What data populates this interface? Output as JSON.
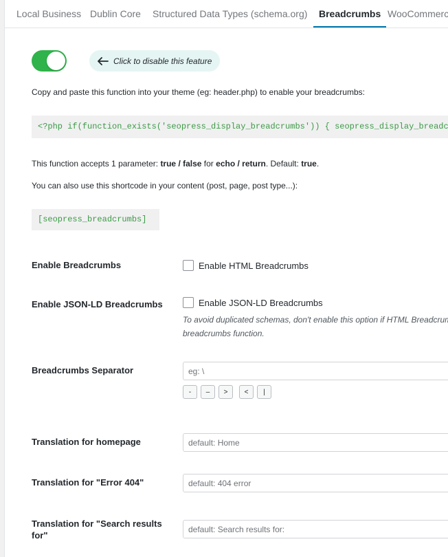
{
  "tabs": [
    {
      "label": "Local Business"
    },
    {
      "label": "Dublin Core"
    },
    {
      "label": "Structured Data Types (schema.org)"
    },
    {
      "label": "Breadcrumbs"
    },
    {
      "label": "WooCommerce"
    }
  ],
  "feature": {
    "toggle_on": true,
    "disable_label": "Click to disable this feature"
  },
  "intro": "Copy and paste this function into your theme (eg: header.php) to enable your breadcrumbs:",
  "code_function": "<?php if(function_exists('seopress_display_breadcrumbs')) { seopress_display_breadcrumbs(); } ?>",
  "param_note": {
    "a": "This function accepts 1 parameter: ",
    "b": "true / false",
    "c": " for ",
    "d": "echo / return",
    "e": ". Default: ",
    "f": "true",
    "g": "."
  },
  "shortcode_note": "You can also use this shortcode in your content (post, page, post type...):",
  "code_shortcode": "[seopress_breadcrumbs]",
  "fields": {
    "enable": {
      "label": "Enable Breadcrumbs",
      "checkbox": "Enable HTML Breadcrumbs",
      "checked": false
    },
    "jsonld": {
      "label": "Enable JSON-LD Breadcrumbs",
      "checkbox": "Enable JSON-LD Breadcrumbs",
      "checked": false,
      "desc1": "To avoid duplicated schemas, don't enable this option if HTML Breadcrumbs",
      "desc2": "breadcrumbs function."
    },
    "separator": {
      "label": "Breadcrumbs Separator",
      "placeholder": "eg: \\",
      "buttons": [
        "-",
        "–",
        ">",
        "<",
        "|"
      ]
    },
    "homepage": {
      "label": "Translation for homepage",
      "placeholder": "default: Home"
    },
    "error404": {
      "label": "Translation for \"Error 404\"",
      "placeholder": "default: 404 error"
    },
    "search": {
      "label1": "Translation for \"Search results",
      "label2": "for\"",
      "placeholder": "default: Search results for:"
    }
  }
}
